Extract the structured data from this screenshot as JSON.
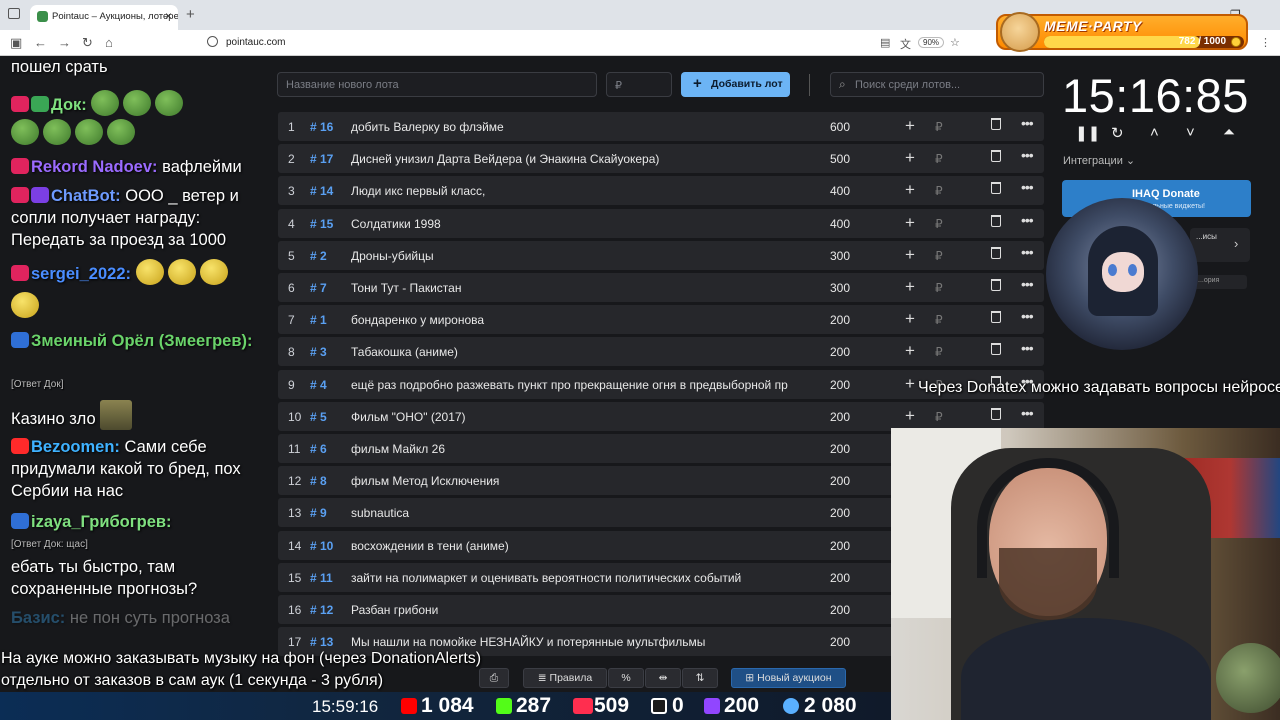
{
  "browser": {
    "tab_title": "Pointauc – Аукционы, лотереи",
    "url": "pointauc.com",
    "zoom": "90%"
  },
  "meme_party": {
    "title": "MEME·PARTY",
    "counter": "782 / 1000",
    "progress": 0.782
  },
  "chat": [
    {
      "nick": "",
      "text": "пошел срать"
    },
    {
      "nick": "Док:",
      "text": ""
    },
    {
      "nick": "Rekord Nadoev:",
      "text": "вафлейми"
    },
    {
      "nick": "ChatBot:",
      "text": "ООО _ ветер и сопли получает награду: Передать за проезд за 1000"
    },
    {
      "nick": "sergei_2022:",
      "text": ""
    },
    {
      "nick": "Змеиный Орёл (Змеегрев):",
      "text": "Казино зло",
      "reply": "[Ответ Док]"
    },
    {
      "nick": "Bezoomen:",
      "text": "Сами себе придумали какой то бред, пох Сербии на нас"
    },
    {
      "nick": "izaya_Грибогрев:",
      "text": "ебать ты быстро, там сохраненные прогнозы?",
      "reply": "[Ответ Док: щас]"
    },
    {
      "nick": "Базис:",
      "text": "не пон суть прогноза"
    }
  ],
  "controls": {
    "new_lot_placeholder": "Название нового лота",
    "amount_placeholder": "₽",
    "add_lot": "Добавить лот",
    "search_placeholder": "Поиск среди лотов..."
  },
  "lots": [
    {
      "idx": "1",
      "num": "# 16",
      "name": "добить Валерку во флэйме",
      "amount": "600"
    },
    {
      "idx": "2",
      "num": "# 17",
      "name": "Дисней унизил Дарта Вейдера (и Энакина Скайуокера)",
      "amount": "500"
    },
    {
      "idx": "3",
      "num": "# 14",
      "name": "Люди икс первый класс,",
      "amount": "400"
    },
    {
      "idx": "4",
      "num": "# 15",
      "name": "Солдатики 1998",
      "amount": "400"
    },
    {
      "idx": "5",
      "num": "# 2",
      "name": "Дроны-убийцы",
      "amount": "300"
    },
    {
      "idx": "6",
      "num": "# 7",
      "name": "Тони Тут - Пакистан",
      "amount": "300"
    },
    {
      "idx": "7",
      "num": "# 1",
      "name": "бондаренко у миронова",
      "amount": "200"
    },
    {
      "idx": "8",
      "num": "# 3",
      "name": "Табакошка (аниме)",
      "amount": "200"
    },
    {
      "idx": "9",
      "num": "# 4",
      "name": "ещё раз подробно разжевать пункт про прекращение огня в предвыборной пр",
      "amount": "200"
    },
    {
      "idx": "10",
      "num": "# 5",
      "name": "Фильм \"ОНО\" (2017)",
      "amount": "200"
    },
    {
      "idx": "11",
      "num": "# 6",
      "name": "фильм Майкл 26",
      "amount": "200"
    },
    {
      "idx": "12",
      "num": "# 8",
      "name": "фильм Метод Исключения",
      "amount": "200"
    },
    {
      "idx": "13",
      "num": "# 9",
      "name": "subnautica",
      "amount": "200"
    },
    {
      "idx": "14",
      "num": "# 10",
      "name": "восхождении в тени (аниме)",
      "amount": "200"
    },
    {
      "idx": "15",
      "num": "# 11",
      "name": "зайти на полимаркет и оценивать вероятности политических событий",
      "amount": "200"
    },
    {
      "idx": "16",
      "num": "# 12",
      "name": "Разбан грибони",
      "amount": "200"
    },
    {
      "idx": "17",
      "num": "# 13",
      "name": "Мы нашли на помойке НЕЗНАЙКУ и потерянные мультфильмы",
      "amount": "200"
    }
  ],
  "row_actions": {
    "plus": "+",
    "rub": "₽",
    "more": "•••"
  },
  "bottom_bar": {
    "rules": "Правила",
    "percent": "%",
    "new_auction": "Новый аукцион"
  },
  "timer": {
    "value": "15:16:85"
  },
  "integrations": {
    "label": "Интеграции",
    "donate_title": "IHAQ Donate",
    "donate_sub": "...уникальные виджеты!",
    "card_label": "...исы",
    "card3": "...ория"
  },
  "captions": {
    "donatex": "Через Donatex можно задавать вопросы нейросети",
    "music_line1": "На ауке можно заказывать музыку на фон (через DonationAlerts)",
    "music_line2": "отдельно от заказов в сам аук (1 секунда - 3 рубля)"
  },
  "stream_stats": {
    "time": "15:59:16",
    "youtube": "1 084",
    "kick": "287",
    "vkplay": "509",
    "rutube": "0",
    "twitch": "200",
    "viewers": "2 080"
  },
  "colors": {
    "accent": "#6cb4f5",
    "lot_number": "#5aa0f2",
    "row_bg": "#26272b"
  }
}
